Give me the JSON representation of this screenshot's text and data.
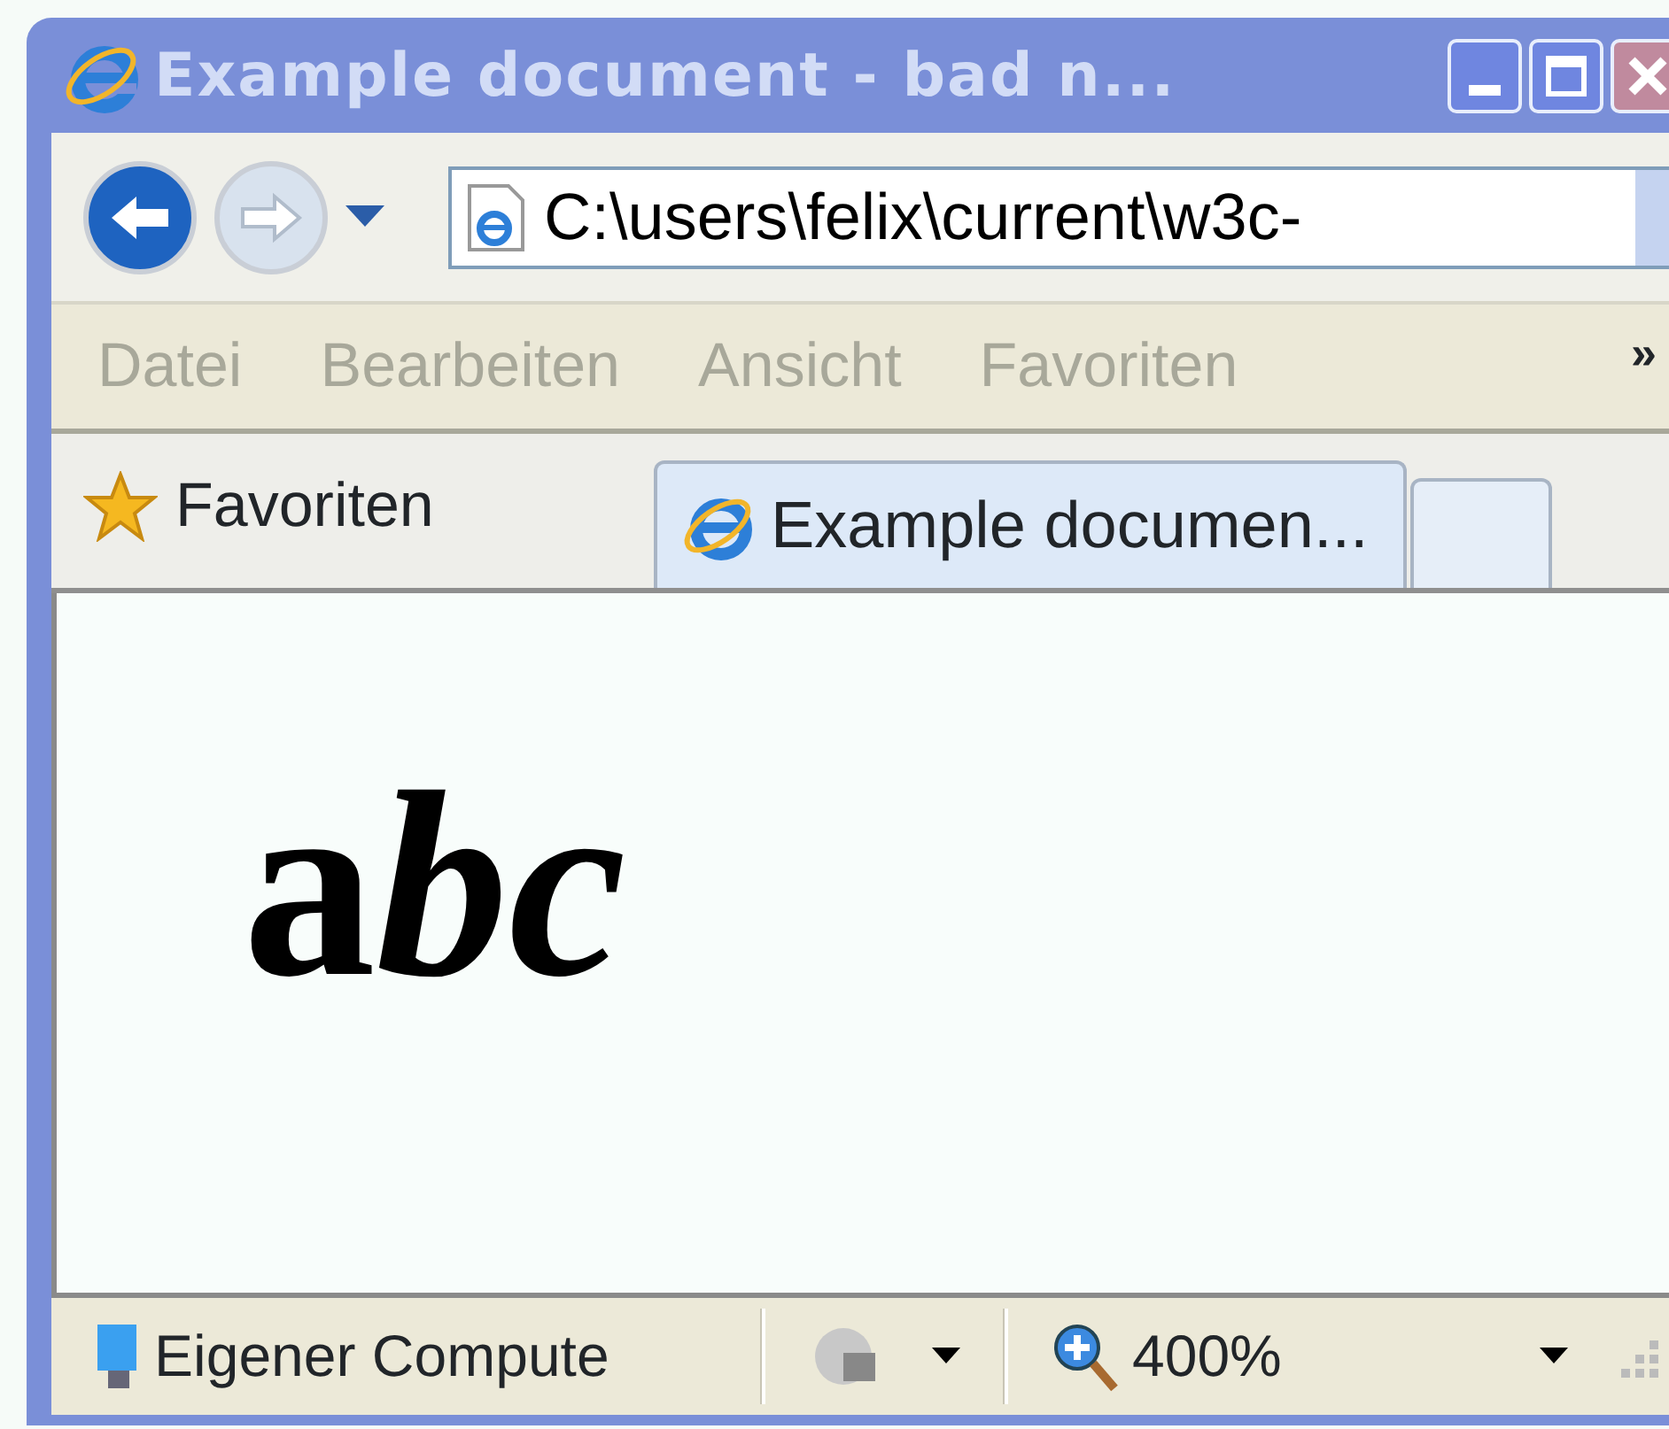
{
  "window": {
    "title": "Example document - bad n...",
    "active": false
  },
  "address_bar": {
    "value": "C:\\users\\felix\\current\\w3c-"
  },
  "menu": [
    {
      "label": "Datei",
      "disabled": true
    },
    {
      "label": "Bearbeiten",
      "disabled": true
    },
    {
      "label": "Ansicht",
      "disabled": true
    },
    {
      "label": "Favoriten",
      "disabled": true
    }
  ],
  "menu_chevron": "»",
  "favorites_button": {
    "label": "Favoriten"
  },
  "tabs": [
    {
      "label": "Example documen...",
      "selected": true
    }
  ],
  "document": {
    "parts": [
      {
        "text": "a",
        "italic": false
      },
      {
        "text": "bc",
        "italic": true
      }
    ]
  },
  "status_bar": {
    "zone": "Eigener Compute",
    "zoom": "400%"
  }
}
